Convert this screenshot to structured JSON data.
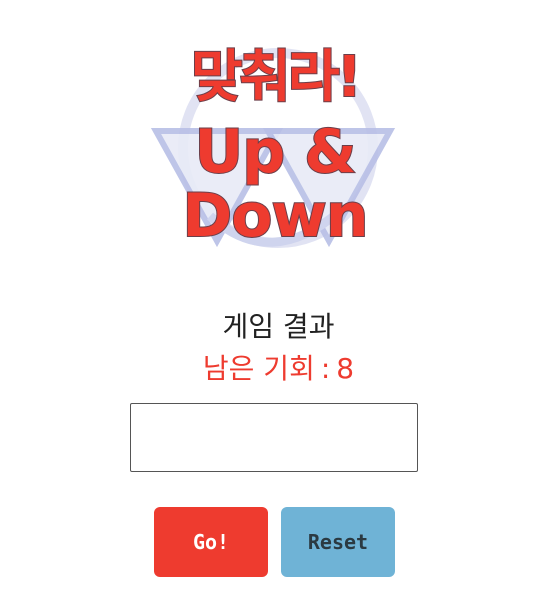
{
  "logo": {
    "line1": "맞춰라!",
    "line2": "Up &",
    "line3": "Down"
  },
  "result": {
    "title": "게임 결과"
  },
  "chances": {
    "label": "남은 기회",
    "separator": ":",
    "count": "8"
  },
  "input": {
    "value": "",
    "placeholder": ""
  },
  "buttons": {
    "go_label": "Go!",
    "reset_label": "Reset"
  },
  "colors": {
    "accent_red": "#ee3b2f",
    "reset_blue": "#6fb3d6"
  }
}
